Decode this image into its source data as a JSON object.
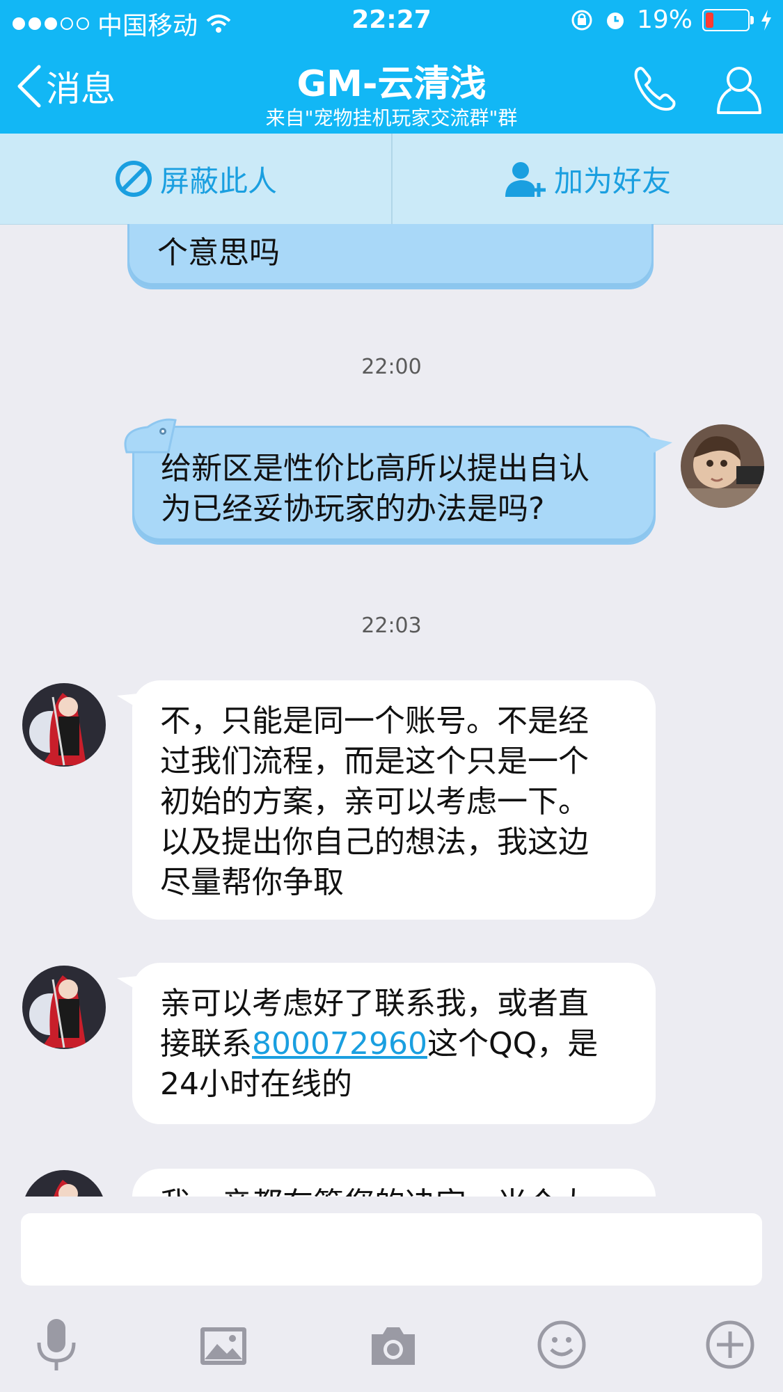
{
  "status_bar": {
    "carrier": "中国移动",
    "time": "22:27",
    "battery_percent": "19%",
    "battery_level": 0.19
  },
  "nav": {
    "back_label": "消息",
    "title": "GM-云清浅",
    "subtitle": "来自\"宠物挂机玩家交流群\"群"
  },
  "actions": {
    "block_label": "屏蔽此人",
    "add_friend_label": "加为好友"
  },
  "messages": [
    {
      "side": "right",
      "text_lines": [
        "个意思吗"
      ]
    },
    {
      "timestamp": "22:00"
    },
    {
      "side": "right",
      "text_lines": [
        "给新区是性价比高所以提出自认",
        "为已经妥协玩家的办法是吗?"
      ]
    },
    {
      "timestamp": "22:03"
    },
    {
      "side": "left",
      "text_lines": [
        "不，只能是同一个账号。不是经",
        "过我们流程，而是这个只是一个",
        "初始的方案，亲可以考虑一下。",
        "以及提出你自己的想法，我这边",
        "尽量帮你争取"
      ]
    },
    {
      "side": "left",
      "line1": "亲可以考虑好了联系我，或者直",
      "line2_before": "接联系",
      "line2_link": "800072960",
      "line2_after": "这个QQ，是",
      "line3": "24小时在线的"
    },
    {
      "side": "left",
      "partial_text": "我，亲都在筹您的决定，当个大"
    }
  ],
  "input": {
    "placeholder": ""
  },
  "colors": {
    "header": "#12b7f5",
    "action_bar": "#cbeaf8",
    "blue_bubble": "#a9d8f8",
    "white_bubble": "#ffffff",
    "link": "#1a9fe0"
  }
}
